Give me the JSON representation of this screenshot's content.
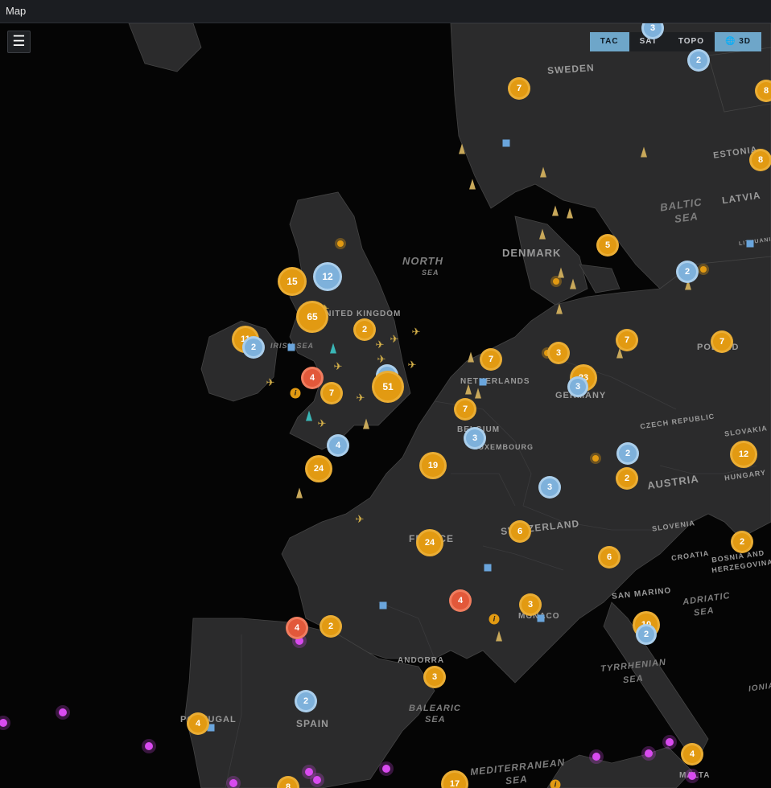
{
  "window": {
    "title": "Map"
  },
  "menu": {
    "icon": "☰"
  },
  "layers": [
    {
      "label": "TAC",
      "active": true
    },
    {
      "label": "SAT",
      "active": false
    },
    {
      "label": "TOPO",
      "active": false
    },
    {
      "label": "🌐 3D",
      "active": true
    }
  ],
  "labels": [
    {
      "text": "SWEDEN",
      "type": "country"
    },
    {
      "text": "ESTONIA",
      "type": "country"
    },
    {
      "text": "LATVIA",
      "type": "country"
    },
    {
      "text": "BALTIC",
      "type": "sea"
    },
    {
      "text": "SEA",
      "type": "sea"
    },
    {
      "text": "NORTH",
      "type": "sea"
    },
    {
      "text": "SEA",
      "type": "sea"
    },
    {
      "text": "DENMARK",
      "type": "country"
    },
    {
      "text": "LITHUANIA",
      "type": "country"
    },
    {
      "text": "UNITED KINGDOM",
      "type": "country"
    },
    {
      "text": "IRISH SEA",
      "type": "sea"
    },
    {
      "text": "NETHERLANDS",
      "type": "country"
    },
    {
      "text": "GERMANY",
      "type": "country"
    },
    {
      "text": "POLAND",
      "type": "country"
    },
    {
      "text": "BELGIUM",
      "type": "country"
    },
    {
      "text": "LUXEMBOURG",
      "type": "country"
    },
    {
      "text": "CZECH REPUBLIC",
      "type": "country"
    },
    {
      "text": "SLOVAKIA",
      "type": "country"
    },
    {
      "text": "HUNGARY",
      "type": "country"
    },
    {
      "text": "AUSTRIA",
      "type": "country"
    },
    {
      "text": "SWITZERLAND",
      "type": "country"
    },
    {
      "text": "SLOVENIA",
      "type": "country"
    },
    {
      "text": "CROATIA",
      "type": "country"
    },
    {
      "text": "BOSNIA AND",
      "type": "country"
    },
    {
      "text": "HERZEGOVINA",
      "type": "country"
    },
    {
      "text": "FRANCE",
      "type": "country"
    },
    {
      "text": "SAN MARINO",
      "type": "country"
    },
    {
      "text": "ADRIATIC",
      "type": "sea"
    },
    {
      "text": "SEA",
      "type": "sea"
    },
    {
      "text": "MONACO",
      "type": "country"
    },
    {
      "text": "ANDORRA",
      "type": "country"
    },
    {
      "text": "TYRRHENIAN",
      "type": "sea"
    },
    {
      "text": "SEA",
      "type": "sea"
    },
    {
      "text": "IONIAN",
      "type": "sea"
    },
    {
      "text": "PORTUGAL",
      "type": "country"
    },
    {
      "text": "SPAIN",
      "type": "country"
    },
    {
      "text": "BALEARIC",
      "type": "sea"
    },
    {
      "text": "SEA",
      "type": "sea"
    },
    {
      "text": "MEDITERRANEAN",
      "type": "sea"
    },
    {
      "text": "SEA",
      "type": "sea"
    },
    {
      "text": "MALTA",
      "type": "country"
    }
  ],
  "clusters": [
    {
      "count": "3",
      "color": "blue"
    },
    {
      "count": "2",
      "color": "blue"
    },
    {
      "count": "7",
      "color": "orange"
    },
    {
      "count": "8",
      "color": "orange"
    },
    {
      "count": "8",
      "color": "orange"
    },
    {
      "count": "5",
      "color": "orange"
    },
    {
      "count": "2",
      "color": "blue"
    },
    {
      "count": "12",
      "color": "blue"
    },
    {
      "count": "15",
      "color": "orange"
    },
    {
      "count": "65",
      "color": "orange"
    },
    {
      "count": "2",
      "color": "orange"
    },
    {
      "count": "11",
      "color": "orange"
    },
    {
      "count": "2",
      "color": "blue"
    },
    {
      "count": "4",
      "color": "red"
    },
    {
      "count": "7",
      "color": "orange"
    },
    {
      "count": "5",
      "color": "blue"
    },
    {
      "count": "51",
      "color": "orange"
    },
    {
      "count": "7",
      "color": "orange"
    },
    {
      "count": "3",
      "color": "orange"
    },
    {
      "count": "23",
      "color": "orange"
    },
    {
      "count": "3",
      "color": "blue"
    },
    {
      "count": "7",
      "color": "orange"
    },
    {
      "count": "7",
      "color": "orange"
    },
    {
      "count": "7",
      "color": "orange"
    },
    {
      "count": "3",
      "color": "blue"
    },
    {
      "count": "4",
      "color": "blue"
    },
    {
      "count": "24",
      "color": "orange"
    },
    {
      "count": "19",
      "color": "orange"
    },
    {
      "count": "2",
      "color": "blue"
    },
    {
      "count": "2",
      "color": "orange"
    },
    {
      "count": "12",
      "color": "orange"
    },
    {
      "count": "3",
      "color": "blue"
    },
    {
      "count": "6",
      "color": "orange"
    },
    {
      "count": "24",
      "color": "orange"
    },
    {
      "count": "6",
      "color": "orange"
    },
    {
      "count": "2",
      "color": "orange"
    },
    {
      "count": "4",
      "color": "red"
    },
    {
      "count": "3",
      "color": "orange"
    },
    {
      "count": "10",
      "color": "orange"
    },
    {
      "count": "2",
      "color": "blue"
    },
    {
      "count": "4",
      "color": "red"
    },
    {
      "count": "2",
      "color": "orange"
    },
    {
      "count": "3",
      "color": "orange"
    },
    {
      "count": "2",
      "color": "blue"
    },
    {
      "count": "4",
      "color": "orange"
    },
    {
      "count": "4",
      "color": "orange"
    },
    {
      "count": "17",
      "color": "orange"
    },
    {
      "count": "8",
      "color": "orange"
    }
  ]
}
